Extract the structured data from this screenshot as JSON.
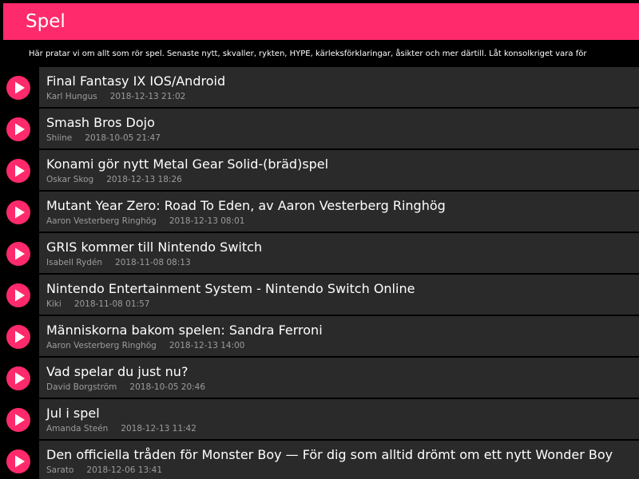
{
  "header": {
    "title": "Spel"
  },
  "description": "Här pratar vi om allt som rör spel. Senaste nytt, skvaller, rykten, HYPE, kärleksförklaringar, åsikter och mer därtill. Låt konsolkriget vara för",
  "colors": {
    "accent": "#fe2a6b",
    "background": "#000000",
    "card": "#2b2a2b",
    "meta_text": "#9c9c9c"
  },
  "icons": {
    "row_icon": "play-icon"
  },
  "threads": [
    {
      "title": "Final Fantasy IX IOS/Android",
      "author": "Karl Hungus",
      "date": "2018-12-13 21:02"
    },
    {
      "title": "Smash Bros Dojo",
      "author": "Shiine",
      "date": "2018-10-05 21:47"
    },
    {
      "title": "Konami gör nytt Metal Gear Solid-(bräd)spel",
      "author": "Oskar Skog",
      "date": "2018-12-13 18:26"
    },
    {
      "title": "Mutant Year Zero: Road To Eden, av Aaron Vesterberg Ringhög",
      "author": "Aaron Vesterberg Ringhög",
      "date": "2018-12-13 08:01"
    },
    {
      "title": "GRIS kommer till Nintendo Switch",
      "author": "Isabell Rydén",
      "date": "2018-11-08 08:13"
    },
    {
      "title": "Nintendo Entertainment System - Nintendo Switch Online",
      "author": "Kiki",
      "date": "2018-11-08 01:57"
    },
    {
      "title": "Människorna bakom spelen: Sandra Ferroni",
      "author": "Aaron Vesterberg Ringhög",
      "date": "2018-12-13 14:00"
    },
    {
      "title": "Vad spelar du just nu?",
      "author": "David Borgström",
      "date": "2018-10-05 20:46"
    },
    {
      "title": "Jul i spel",
      "author": "Amanda Steén",
      "date": "2018-12-13 11:42"
    },
    {
      "title": "Den officiella tråden för Monster Boy — För dig som alltid drömt om ett nytt Wonder Boy",
      "author": "Sarato",
      "date": "2018-12-06 13:41"
    }
  ]
}
